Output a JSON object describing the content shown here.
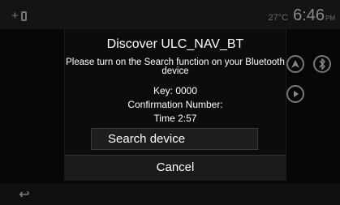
{
  "status": {
    "add_label": "+",
    "temperature": "27°C",
    "time": "6:46",
    "ampm": "PM"
  },
  "dialog": {
    "title": "Discover ULC_NAV_BT",
    "message": "Please turn on the Search function on  your Bluetooth device",
    "key": "Key: 0000",
    "confirmation": "Confirmation Number:",
    "time_left": "Time 2:57",
    "search_button": "Search device",
    "cancel_button": "Cancel"
  },
  "bottom": {
    "back_glyph": "↩"
  },
  "icons": [
    "navigation-arrow-icon",
    "bluetooth-icon",
    "play-icon"
  ]
}
